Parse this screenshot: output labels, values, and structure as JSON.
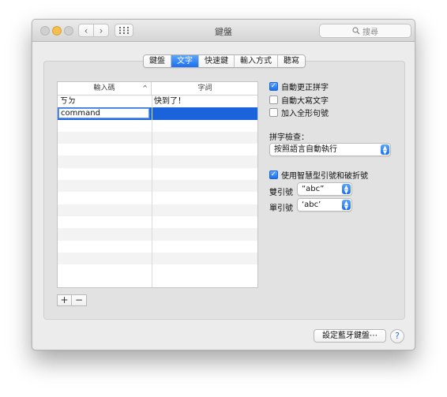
{
  "window": {
    "title": "鍵盤"
  },
  "toolbar": {
    "back_glyph": "‹",
    "forward_glyph": "›",
    "search_placeholder": "搜尋"
  },
  "tabs": [
    {
      "label": "鍵盤",
      "active": false
    },
    {
      "label": "文字",
      "active": true
    },
    {
      "label": "快速鍵",
      "active": false
    },
    {
      "label": "輸入方式",
      "active": false
    },
    {
      "label": "聽寫",
      "active": false
    }
  ],
  "table": {
    "col_replace": "輸入碼",
    "col_with": "字詞",
    "sort_glyph": "^",
    "rows": [
      {
        "replace": "ㄎㄉ",
        "with": "快到了！"
      },
      {
        "replace": "command",
        "with": ""
      }
    ]
  },
  "list_controls": {
    "add_label": "+",
    "remove_label": "−"
  },
  "options": {
    "auto_correct": {
      "label": "自動更正拼字",
      "checked": true
    },
    "auto_capitalize": {
      "label": "自動大寫文字",
      "checked": false
    },
    "double_space_period": {
      "label": "加入全形句號",
      "checked": false
    }
  },
  "spelling": {
    "label": "拼字檢查：",
    "value": "按照語言自動執行"
  },
  "smart_quotes": {
    "label": "使用智慧型引號和破折號",
    "checked": true,
    "double_label": "雙引號",
    "double_value": "“abc”",
    "single_label": "單引號",
    "single_value": "‘abc’"
  },
  "footer": {
    "bluetooth_button": "設定藍牙鍵盤⋯",
    "help_label": "?"
  },
  "colors": {
    "accent": "#1c6ff0",
    "selection": "#1b63db"
  }
}
